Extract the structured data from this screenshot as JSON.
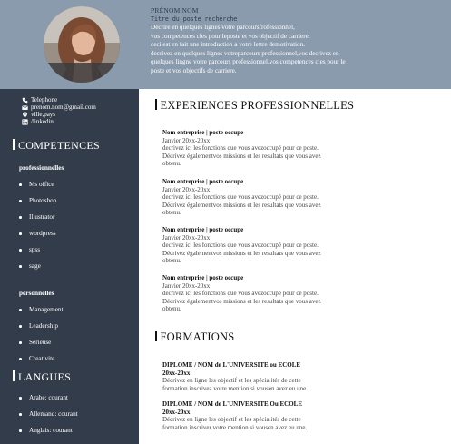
{
  "header": {
    "name": "PRÉNOM NOM",
    "job_title": "Titre du poste recherche",
    "intro_lines": [
      "Decrire en quelques lignes votre parcoursfrofessionnel,",
      "vos competences cles pour leposte et vos objectif de carriere.",
      "ceci est en fait une introduction a votre lettre demotivation.",
      "decrivez en quelques lignes votreparcours professionnel,vos decrivez en",
      "quelques lingne votre parcours professionnel,vos competences cles pour le",
      "poste et vos objectifs de carriere."
    ]
  },
  "contact": {
    "phone": "Telephone",
    "email": "prenom.nom@gmail.com",
    "location": "ville,pays",
    "linkedin": "/linkedin"
  },
  "competences": {
    "title": "COMPETENCES",
    "pro_title": "professionnelles",
    "pro_items": [
      "Ms office",
      "Photoshop",
      "Illustrator",
      "wordpress",
      "spss",
      "sage"
    ],
    "perso_title": "personnelles",
    "perso_items": [
      "Management",
      "Leadership",
      "Serieuse",
      "Creativite"
    ]
  },
  "langues": {
    "title": "LANGUES",
    "items": [
      "Arabe: courant",
      "Allemand: courant",
      "Anglais: courant"
    ]
  },
  "experiences": {
    "title": "EXPERIENCES PROFESSIONNELLES",
    "jobs": [
      {
        "title": "Nom entreprise | poste occupe",
        "date": "Janvier 20xx-20xx",
        "desc": [
          "decrivez ici les fonctions que vous avezoccupé pour ce poste.",
          "Décrivez égalementvos missions et les resultats que vous avez",
          "obtenu."
        ]
      },
      {
        "title": "Nom entreprise | poste occupe",
        "date": "Janvier 20xx-20xx",
        "desc": [
          "decrivez ici les fonctions que vous avezoccupé pour ce poste.",
          "Décrivez égalementvos missions et les resultats que vous avez",
          "obtenu."
        ]
      },
      {
        "title": "Nom entreprise | poste occupe",
        "date": "Janvier 20xx-20xx",
        "desc": [
          "decrivez ici les fonctions que vous avezoccupé pour ce poste.",
          "Décrivez égalementvos missions et les resultats que vous avez",
          "obtenu."
        ]
      },
      {
        "title": "Nom entreprise | poste occupe",
        "date": "Janvier 20xx-20xx",
        "desc": [
          "decrivez ici les fonctions que vous avezoccupé pour ce poste.",
          "Décrivez égalementvos missions et les resultats que vous avez",
          "obtenu."
        ]
      }
    ]
  },
  "formations": {
    "title": "FORMATIONS",
    "items": [
      {
        "title": "DIPLOME / NOM de L'UNIVERSITE ou ECOLE",
        "year": "20xx-20xx",
        "desc": [
          "Décrivez en ligne les objectif et les spécialités de cette",
          "formation.inscrivez votre mention si vousen avez eu une."
        ]
      },
      {
        "title": "DIPLOME / NOM de L'UNIVERSITE Ou ECOLE",
        "year": "20xx-20xx",
        "desc": [
          "Décrivez en ligne les objectif et les spécialités de cette",
          "formation.inscriver votre mention si vousen avez eu une."
        ]
      }
    ]
  },
  "colors": {
    "header_bg": "#8a9bad",
    "sidebar_bg": "#333c4a",
    "text_dark": "#222222"
  }
}
